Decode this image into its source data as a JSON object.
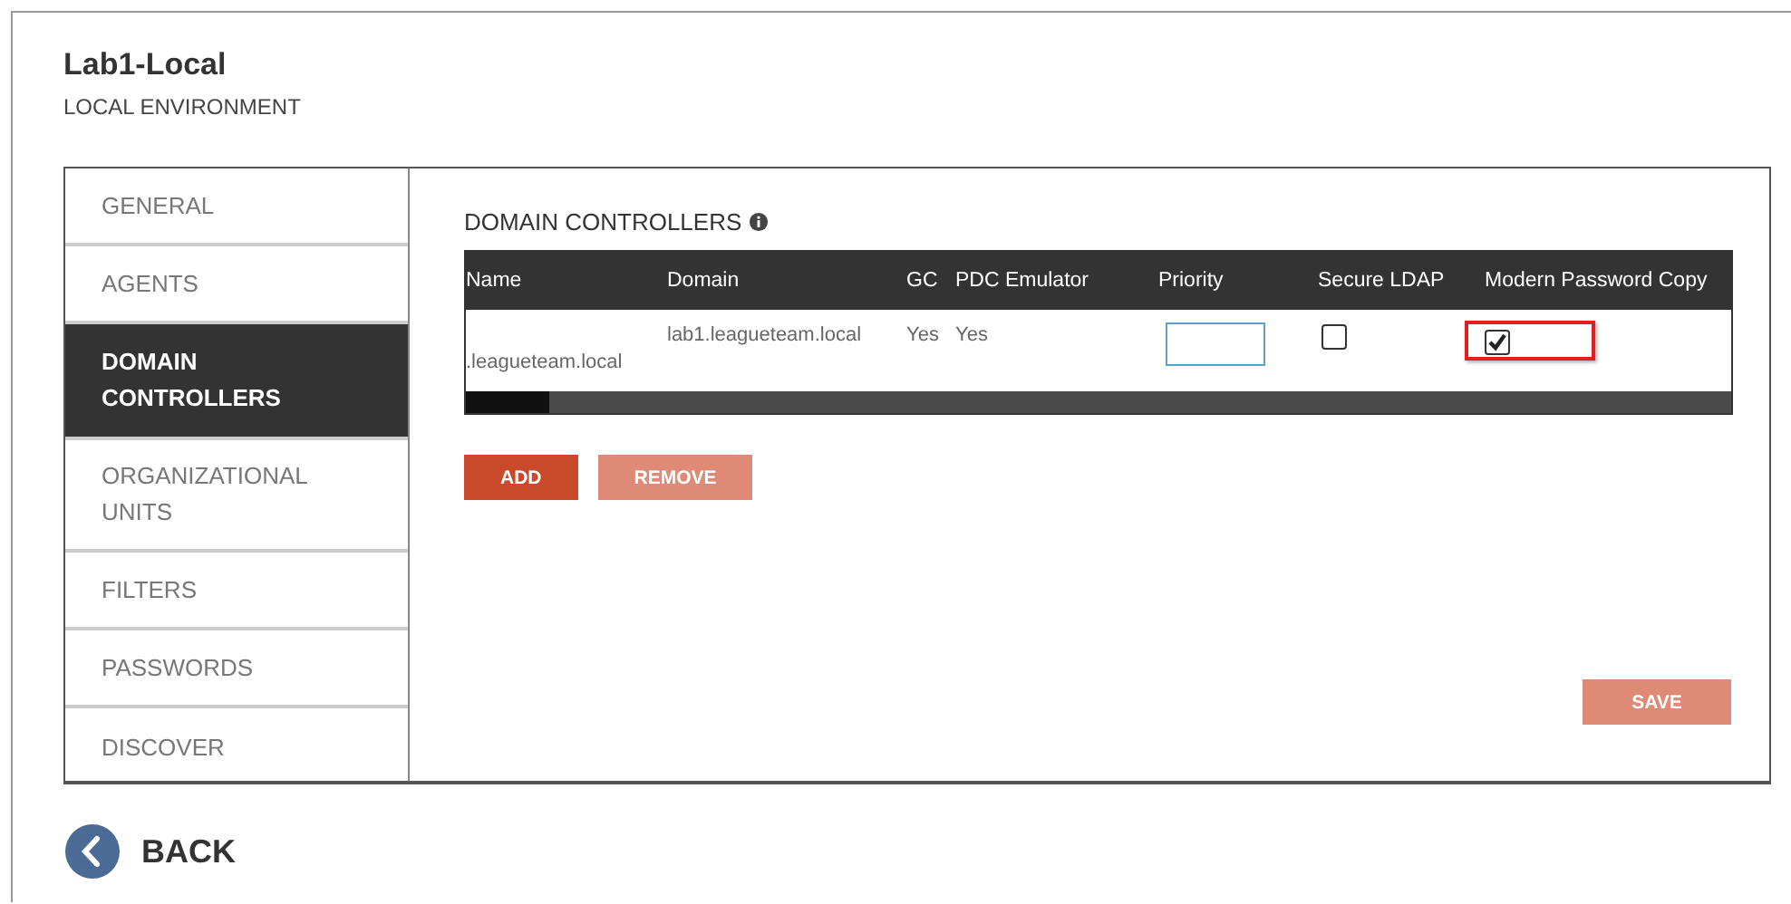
{
  "header": {
    "title": "Lab1-Local",
    "subtitle": "LOCAL ENVIRONMENT"
  },
  "sidebar": {
    "items": [
      {
        "label": "GENERAL",
        "selected": false
      },
      {
        "label": "AGENTS",
        "selected": false
      },
      {
        "label": "DOMAIN CONTROLLERS",
        "selected": true
      },
      {
        "label": "ORGANIZATIONAL UNITS",
        "selected": false
      },
      {
        "label": "FILTERS",
        "selected": false
      },
      {
        "label": "PASSWORDS",
        "selected": false
      },
      {
        "label": "DISCOVER",
        "selected": false
      }
    ]
  },
  "section": {
    "title": "DOMAIN CONTROLLERS"
  },
  "table": {
    "columns": [
      "Name",
      "Domain",
      "GC",
      "PDC Emulator",
      "Priority",
      "Secure LDAP",
      "Modern Password Copy"
    ],
    "rows": [
      {
        "name": ".leagueteam.local",
        "domain": "lab1.leagueteam.local",
        "gc": "Yes",
        "pdc_emulator": "Yes",
        "secure_ldap": {
          "checked": false
        },
        "modern_password_copy": {
          "checked": true,
          "highlighted": true
        }
      }
    ]
  },
  "buttons": [
    {
      "label": "ADD",
      "disabled": false
    },
    {
      "label": "REMOVE",
      "disabled": true
    }
  ],
  "save_button": {
    "label": "SAVE",
    "disabled": true
  },
  "back": {
    "label": "BACK"
  }
}
